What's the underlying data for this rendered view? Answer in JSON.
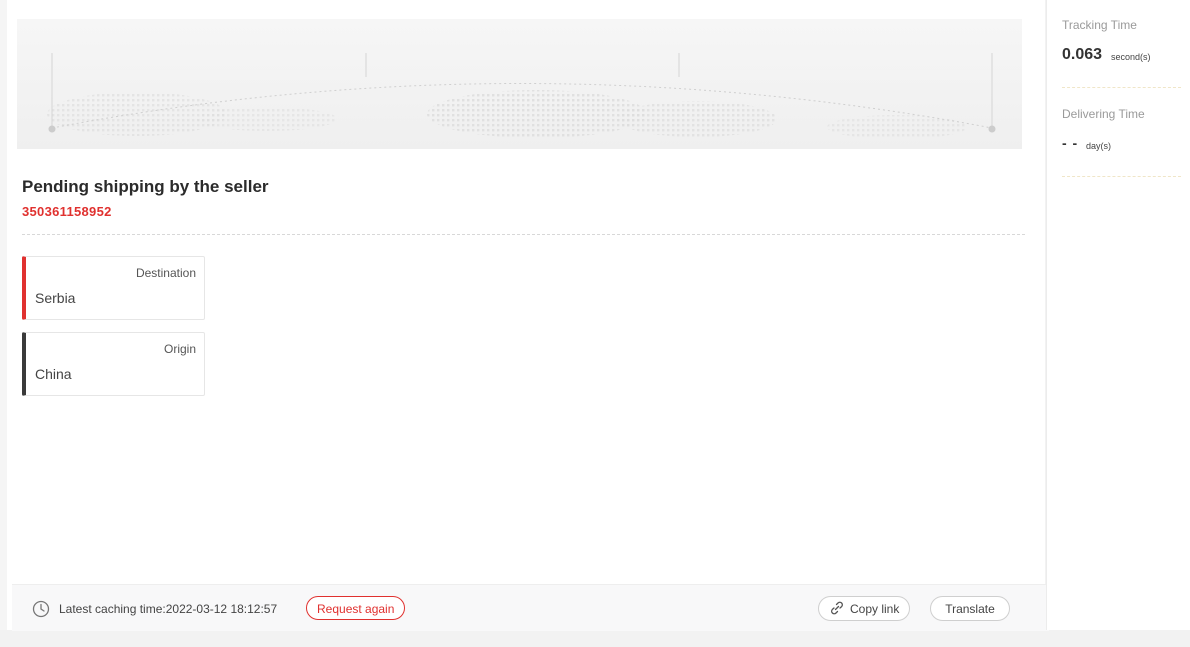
{
  "shipment": {
    "status_title": "Pending shipping by the seller",
    "tracking_number": "350361158952"
  },
  "route": {
    "destination": {
      "label": "Destination",
      "value": "Serbia",
      "accent": "#e0312f"
    },
    "origin": {
      "label": "Origin",
      "value": "China",
      "accent": "#3a3a3a"
    }
  },
  "footer": {
    "clock_icon": "clock-icon",
    "cache_text": "Latest caching time:2022-03-12 18:12:57",
    "request_again_label": "Request again",
    "copy_link_icon": "link-icon",
    "copy_link_label": "Copy link",
    "translate_label": "Translate"
  },
  "sidebar": {
    "tracking_time": {
      "label": "Tracking Time",
      "value": "0.063",
      "unit": "second(s)"
    },
    "delivering_time": {
      "label": "Delivering Time",
      "value": "- -",
      "unit": "day(s)"
    }
  },
  "colors": {
    "accent_red": "#e0312f",
    "text_dark": "#333333",
    "muted": "#9a9a9a"
  }
}
